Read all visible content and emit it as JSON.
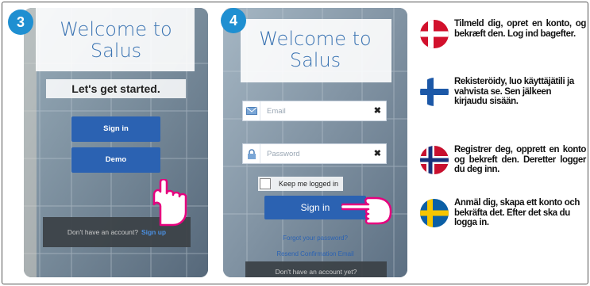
{
  "steps": {
    "step3": {
      "number": "3",
      "title": "Welcome to Salus",
      "tagline": "Let's get started.",
      "sign_in_label": "Sign in",
      "demo_label": "Demo",
      "no_account_text": "Don't have an account?",
      "sign_up_label": "Sign up"
    },
    "step4": {
      "number": "4",
      "title": "Welcome to Salus",
      "email_placeholder": "Email",
      "password_placeholder": "Password",
      "keep_logged_in_label": "Keep me logged in",
      "sign_in_label": "Sign in",
      "forgot_label": "Forgot your password?",
      "resend_label": "Resend Confirmation Email",
      "no_account_text": "Don't have an account yet?"
    }
  },
  "instructions": [
    {
      "language": "Danish",
      "flag": "denmark-flag-icon",
      "text": "Tilmeld dig, opret en konto, og bekræft den. Log ind bagefter."
    },
    {
      "language": "Finnish",
      "flag": "finland-flag-icon",
      "text": "Rekisteröidy, luo käyttäjätili ja vahvista se. Sen jälkeen kirjaudu sisään."
    },
    {
      "language": "Norwegian",
      "flag": "norway-flag-icon",
      "text": "Registrer deg, opprett en konto og bekreft den. Deretter logger du deg inn."
    },
    {
      "language": "Swedish",
      "flag": "sweden-flag-icon",
      "text": "Anmäl dig, skapa ett konto och bekräfta det. Efter det ska du logga in."
    }
  ],
  "colors": {
    "badge": "#1f8fd1",
    "button": "#2b62b2",
    "title": "#3a73b2",
    "hand": "#e6007e"
  }
}
